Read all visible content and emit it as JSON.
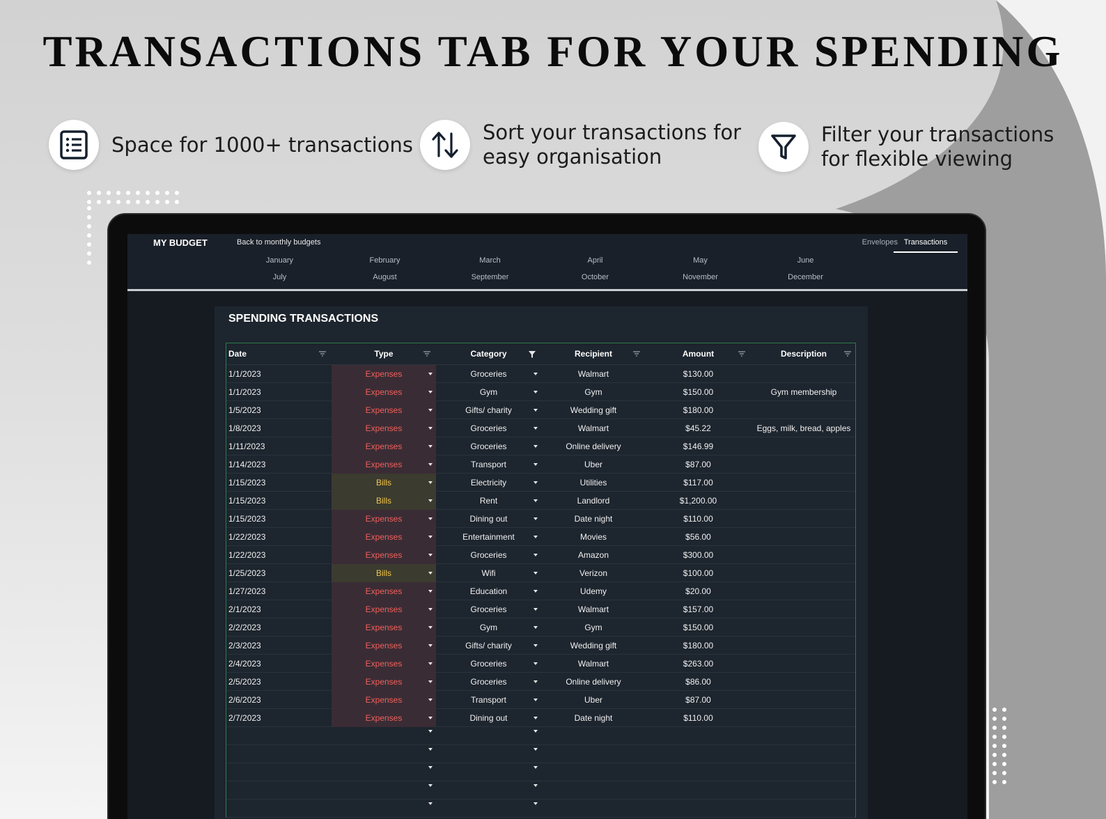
{
  "headline": "TRANSACTIONS TAB FOR YOUR SPENDING",
  "features": [
    {
      "icon": "list-icon",
      "text": "Space for 1000+ transactions"
    },
    {
      "icon": "sort-arrows-icon",
      "text": "Sort your transactions for\neasy organisation"
    },
    {
      "icon": "filter-icon",
      "text": "Filter your transactions\nfor flexible viewing"
    }
  ],
  "colors": {
    "expense_text": "#f0605a",
    "expense_bg": "#3a2c35",
    "bill_text": "#f2c548",
    "bill_bg": "#3b3b30",
    "table_border": "#2b7a4b"
  },
  "nav": {
    "brand": "MY BUDGET",
    "back_link": "Back to monthly budgets",
    "months": [
      "January",
      "February",
      "March",
      "April",
      "May",
      "June",
      "July",
      "August",
      "September",
      "October",
      "November",
      "December"
    ],
    "tabs": {
      "envelopes": "Envelopes",
      "transactions": "Transactions"
    }
  },
  "panel_title": "SPENDING TRANSACTIONS",
  "table": {
    "headers": {
      "date": "Date",
      "type": "Type",
      "category": "Category",
      "recipient": "Recipient",
      "amount": "Amount",
      "description": "Description"
    },
    "rows": [
      {
        "date": "1/1/2023",
        "type": "Expenses",
        "category": "Groceries",
        "recipient": "Walmart",
        "amount": "$130.00",
        "description": ""
      },
      {
        "date": "1/1/2023",
        "type": "Expenses",
        "category": "Gym",
        "recipient": "Gym",
        "amount": "$150.00",
        "description": "Gym membership"
      },
      {
        "date": "1/5/2023",
        "type": "Expenses",
        "category": "Gifts/ charity",
        "recipient": "Wedding gift",
        "amount": "$180.00",
        "description": ""
      },
      {
        "date": "1/8/2023",
        "type": "Expenses",
        "category": "Groceries",
        "recipient": "Walmart",
        "amount": "$45.22",
        "description": "Eggs, milk, bread, apples"
      },
      {
        "date": "1/11/2023",
        "type": "Expenses",
        "category": "Groceries",
        "recipient": "Online delivery",
        "amount": "$146.99",
        "description": ""
      },
      {
        "date": "1/14/2023",
        "type": "Expenses",
        "category": "Transport",
        "recipient": "Uber",
        "amount": "$87.00",
        "description": ""
      },
      {
        "date": "1/15/2023",
        "type": "Bills",
        "category": "Electricity",
        "recipient": "Utilities",
        "amount": "$117.00",
        "description": ""
      },
      {
        "date": "1/15/2023",
        "type": "Bills",
        "category": "Rent",
        "recipient": "Landlord",
        "amount": "$1,200.00",
        "description": ""
      },
      {
        "date": "1/15/2023",
        "type": "Expenses",
        "category": "Dining out",
        "recipient": "Date night",
        "amount": "$110.00",
        "description": ""
      },
      {
        "date": "1/22/2023",
        "type": "Expenses",
        "category": "Entertainment",
        "recipient": "Movies",
        "amount": "$56.00",
        "description": ""
      },
      {
        "date": "1/22/2023",
        "type": "Expenses",
        "category": "Groceries",
        "recipient": "Amazon",
        "amount": "$300.00",
        "description": ""
      },
      {
        "date": "1/25/2023",
        "type": "Bills",
        "category": "Wifi",
        "recipient": "Verizon",
        "amount": "$100.00",
        "description": ""
      },
      {
        "date": "1/27/2023",
        "type": "Expenses",
        "category": "Education",
        "recipient": "Udemy",
        "amount": "$20.00",
        "description": ""
      },
      {
        "date": "2/1/2023",
        "type": "Expenses",
        "category": "Groceries",
        "recipient": "Walmart",
        "amount": "$157.00",
        "description": ""
      },
      {
        "date": "2/2/2023",
        "type": "Expenses",
        "category": "Gym",
        "recipient": "Gym",
        "amount": "$150.00",
        "description": ""
      },
      {
        "date": "2/3/2023",
        "type": "Expenses",
        "category": "Gifts/ charity",
        "recipient": "Wedding gift",
        "amount": "$180.00",
        "description": ""
      },
      {
        "date": "2/4/2023",
        "type": "Expenses",
        "category": "Groceries",
        "recipient": "Walmart",
        "amount": "$263.00",
        "description": ""
      },
      {
        "date": "2/5/2023",
        "type": "Expenses",
        "category": "Groceries",
        "recipient": "Online delivery",
        "amount": "$86.00",
        "description": ""
      },
      {
        "date": "2/6/2023",
        "type": "Expenses",
        "category": "Transport",
        "recipient": "Uber",
        "amount": "$87.00",
        "description": ""
      },
      {
        "date": "2/7/2023",
        "type": "Expenses",
        "category": "Dining out",
        "recipient": "Date night",
        "amount": "$110.00",
        "description": ""
      }
    ],
    "empty_rows": 5
  }
}
